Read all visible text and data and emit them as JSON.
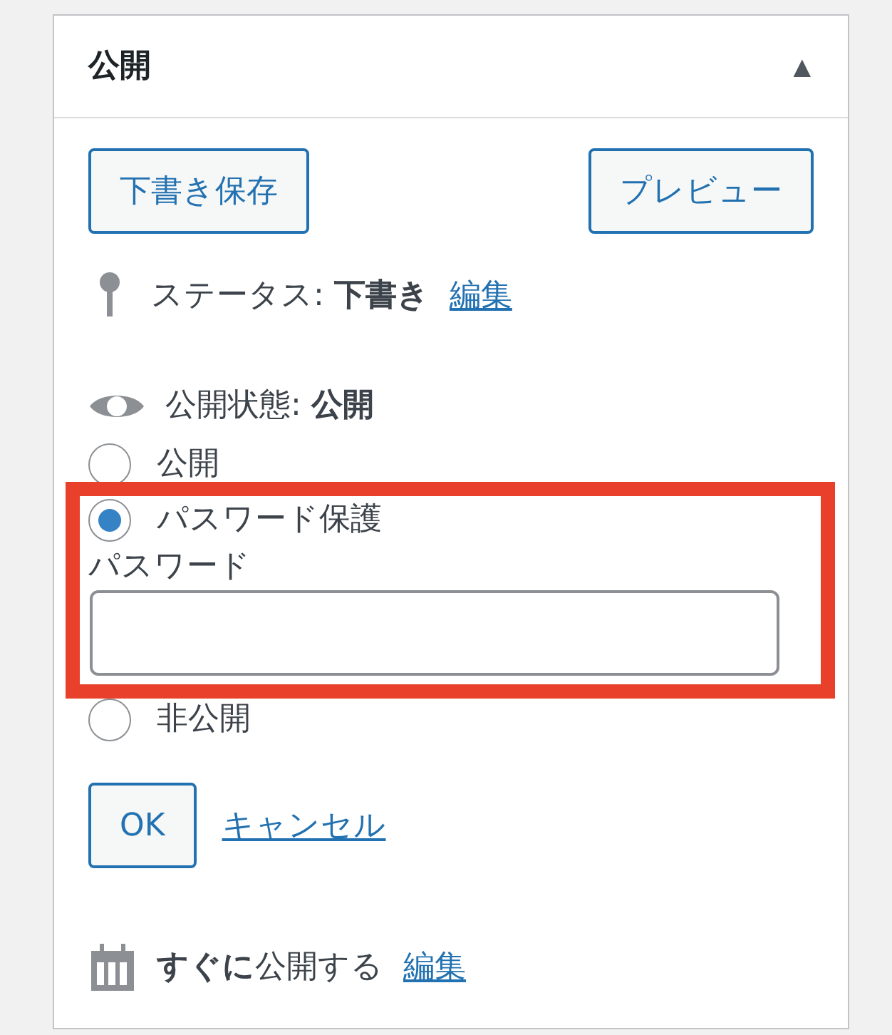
{
  "panel": {
    "title": "公開",
    "collapse_icon": "▲"
  },
  "actions": [
    {
      "label": "下書き保存"
    },
    {
      "label": "プレビュー"
    }
  ],
  "status": {
    "text": "ステータス: **下書き**",
    "edit_link": "編集"
  },
  "visibility": {
    "text": "公開状態: **公開**",
    "options": [
      {
        "label": "公開",
        "selected": false
      },
      {
        "label": "パスワード保護",
        "selected": true
      },
      {
        "label": "非公開",
        "selected": false
      }
    ],
    "password": {
      "label": "パスワード"
    },
    "ok_button": "OK",
    "cancel_link": "キャンセル"
  },
  "schedule": {
    "text": "**すぐに**公開する",
    "edit_link": "編集"
  },
  "highlight": {
    "visible": true,
    "color": "#e8402a"
  }
}
